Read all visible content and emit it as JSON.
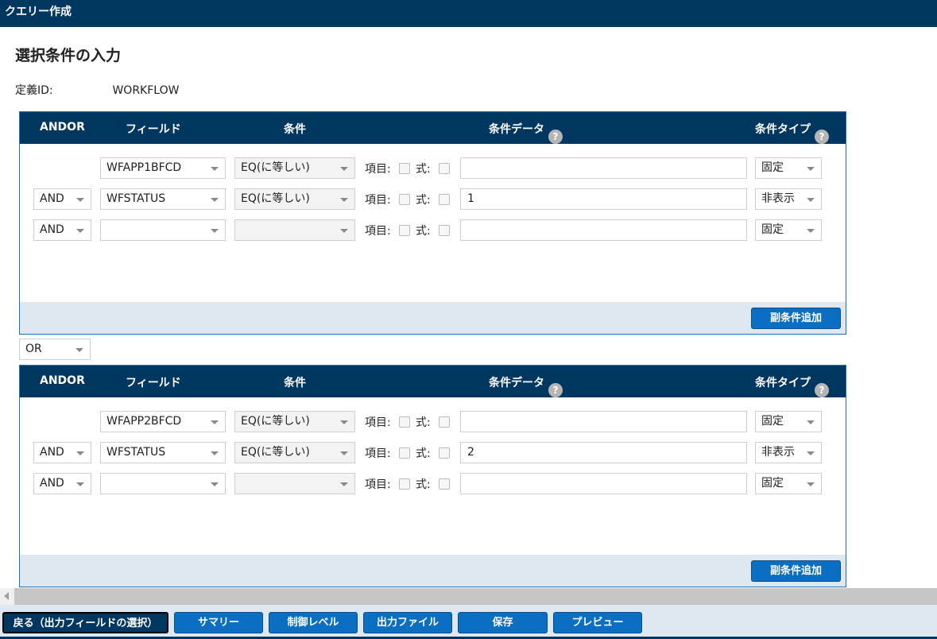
{
  "window": {
    "title": "クエリー作成"
  },
  "page": {
    "heading": "選択条件の入力",
    "def_label": "定義ID:",
    "def_value": "WORKFLOW"
  },
  "columns": {
    "andor": "ANDOR",
    "field": "フィールド",
    "condition": "条件",
    "data": "条件データ",
    "type": "条件タイプ",
    "help": "?"
  },
  "labels": {
    "item": "項目:",
    "expr": "式:"
  },
  "groups": [
    {
      "rows": [
        {
          "andor": "",
          "field": "WFAPP1BFCD",
          "cond": "EQ(に等しい)",
          "data": "",
          "type": "固定"
        },
        {
          "andor": "AND",
          "field": "WFSTATUS",
          "cond": "EQ(に等しい)",
          "data": "1",
          "type": "非表示"
        },
        {
          "andor": "AND",
          "field": "",
          "cond": "",
          "data": "",
          "type": "固定"
        }
      ],
      "add_button": "副条件追加"
    },
    {
      "rows": [
        {
          "andor": "",
          "field": "WFAPP2BFCD",
          "cond": "EQ(に等しい)",
          "data": "",
          "type": "固定"
        },
        {
          "andor": "AND",
          "field": "WFSTATUS",
          "cond": "EQ(に等しい)",
          "data": "2",
          "type": "非表示"
        },
        {
          "andor": "AND",
          "field": "",
          "cond": "",
          "data": "",
          "type": "固定"
        }
      ],
      "add_button": "副条件追加"
    }
  ],
  "group_join": "OR",
  "footer": {
    "back": "戻る（出力フィールドの選択）",
    "summary": "サマリー",
    "control_level": "制御レベル",
    "output_file": "出力ファイル",
    "save": "保存",
    "preview": "プレビュー"
  },
  "colors": {
    "header": "#003760",
    "button": "#0a6fc2",
    "panel": "#dfe8f1"
  }
}
